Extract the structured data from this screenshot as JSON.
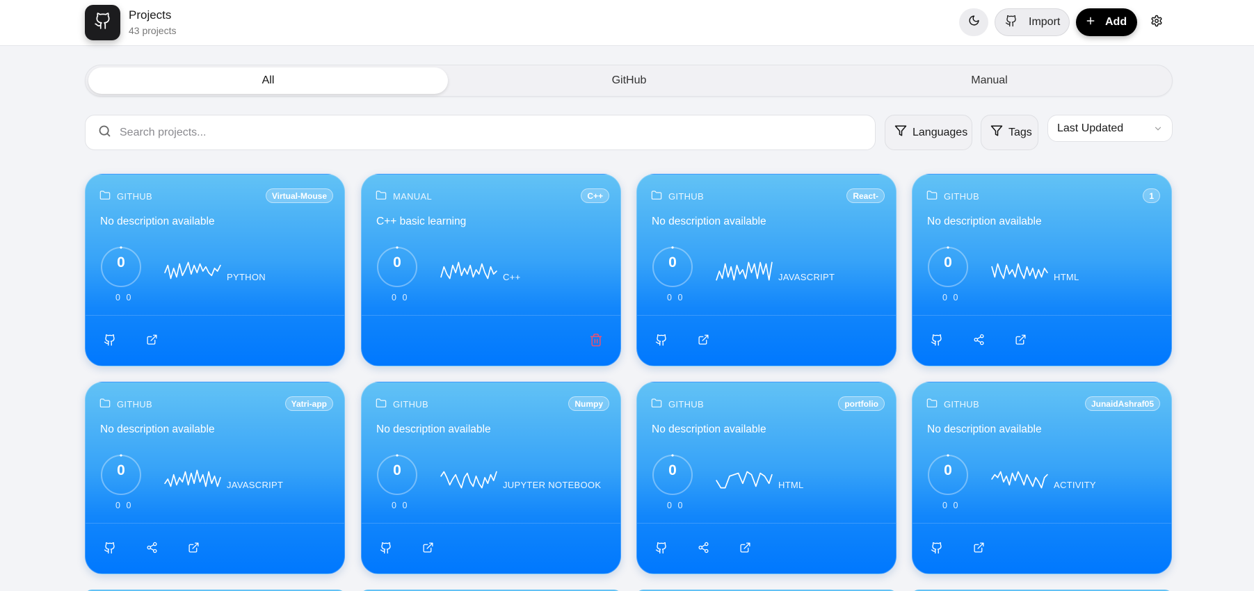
{
  "header": {
    "title": "Projects",
    "subtitle": "43 projects",
    "import_label": "Import",
    "add_label": "Add"
  },
  "tabs": [
    {
      "label": "All",
      "active": true
    },
    {
      "label": "GitHub",
      "active": false
    },
    {
      "label": "Manual",
      "active": false
    }
  ],
  "search": {
    "placeholder": "Search projects...",
    "value": ""
  },
  "filters": {
    "languages_label": "Languages",
    "tags_label": "Tags",
    "sort_value": "Last Updated"
  },
  "cards": [
    {
      "source": "GITHUB",
      "badge": "Virtual-Mouse",
      "description": "No description available",
      "score": "0",
      "a": "0",
      "b": "0",
      "language": "PYTHON",
      "actions": [
        "github",
        "open"
      ]
    },
    {
      "source": "MANUAL",
      "badge": "C++",
      "description": "C++ basic learning",
      "score": "0",
      "a": "0",
      "b": "0",
      "language": "C++",
      "actions": [
        "delete"
      ]
    },
    {
      "source": "GITHUB",
      "badge": "React-",
      "description": "No description available",
      "score": "0",
      "a": "0",
      "b": "0",
      "language": "JAVASCRIPT",
      "actions": [
        "github",
        "open"
      ]
    },
    {
      "source": "GITHUB",
      "badge": "1",
      "description": "No description available",
      "score": "0",
      "a": "0",
      "b": "0",
      "language": "HTML",
      "actions": [
        "github",
        "share",
        "open"
      ]
    },
    {
      "source": "GITHUB",
      "badge": "Yatri-app",
      "description": "No description available",
      "score": "0",
      "a": "0",
      "b": "0",
      "language": "JAVASCRIPT",
      "actions": [
        "github",
        "share",
        "open"
      ]
    },
    {
      "source": "GITHUB",
      "badge": "Numpy",
      "description": "No description available",
      "score": "0",
      "a": "0",
      "b": "0",
      "language": "JUPYTER NOTEBOOK",
      "actions": [
        "github",
        "open"
      ]
    },
    {
      "source": "GITHUB",
      "badge": "portfolio",
      "description": "No description available",
      "score": "0",
      "a": "0",
      "b": "0",
      "language": "HTML",
      "actions": [
        "github",
        "share",
        "open"
      ]
    },
    {
      "source": "GITHUB",
      "badge": "JunaidAshraf05",
      "description": "No description available",
      "score": "0",
      "a": "0",
      "b": "0",
      "language": "ACTIVITY",
      "actions": [
        "github",
        "open"
      ]
    }
  ],
  "colors": {
    "card_top": "#62c2f5",
    "card_bottom": "#0078fe",
    "delete": "#f0506e",
    "primary_button": "#000000"
  }
}
